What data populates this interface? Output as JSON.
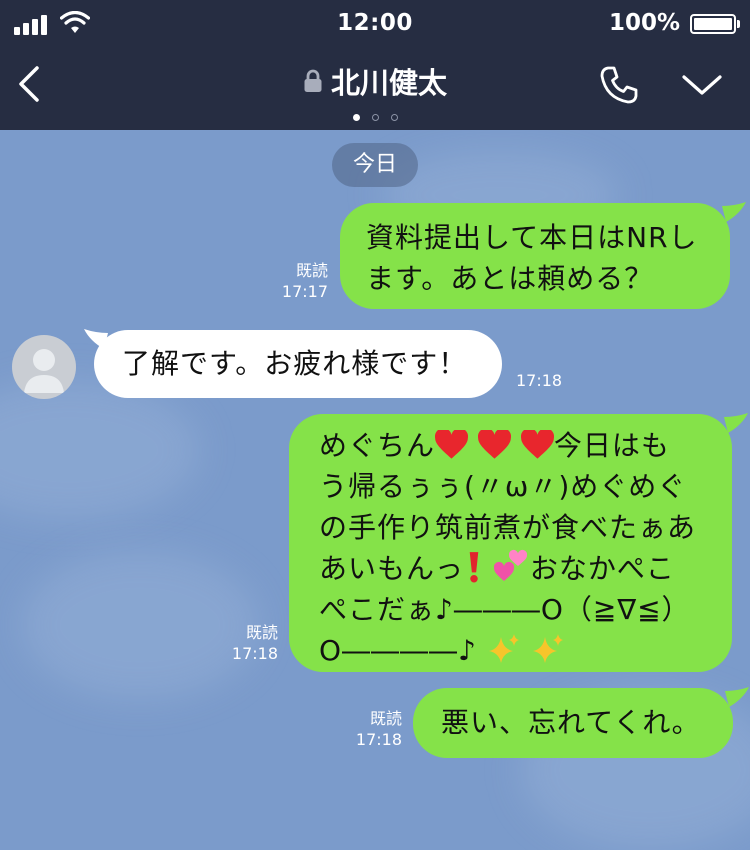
{
  "status": {
    "time": "12:00",
    "battery": "100%",
    "battery_level": 1.0
  },
  "header": {
    "title": "北川健太",
    "pages": 3,
    "active_page": 0
  },
  "date_divider": "今日",
  "messages": [
    {
      "from": "me",
      "read": "既読",
      "time": "17:17",
      "lines": [
        "資料提出して本日はNRし",
        "ます。あとは頼める？"
      ]
    },
    {
      "from": "contact",
      "time": "17:18",
      "text": "了解です。お疲れ様です！"
    },
    {
      "from": "me",
      "read": "既読",
      "time": "17:18",
      "l1a": "めぐちん",
      "l1b": "今日はも",
      "l2": "う帰るぅぅ(〃ω〃)めぐめぐ",
      "l3": "の手作り筑前煮が食べたぁあ",
      "l4a": "あいもんっ",
      "l4b": "おなかぺこ",
      "l5": "ぺこだぁ♪―――O（≧∇≦）",
      "l6": "O――――♪"
    },
    {
      "from": "me",
      "read": "既読",
      "time": "17:18",
      "text": "悪い、忘れてくれ。"
    }
  ],
  "icons": [
    "signal-icon",
    "wifi-icon",
    "battery-icon",
    "back-icon",
    "lock-icon",
    "phone-icon",
    "chevron-down-icon",
    "avatar-icon",
    "heart-icon",
    "exclamation-icon",
    "sparkling-heart-icon",
    "sparkles-icon"
  ],
  "colors": {
    "header": "#262d42",
    "background": "#7b9bcb",
    "outgoing": "#85e249",
    "incoming": "#ffffff",
    "heart": "#e8262d",
    "sparkle": "#f6c52b",
    "pink_heart": "#f052a8"
  }
}
